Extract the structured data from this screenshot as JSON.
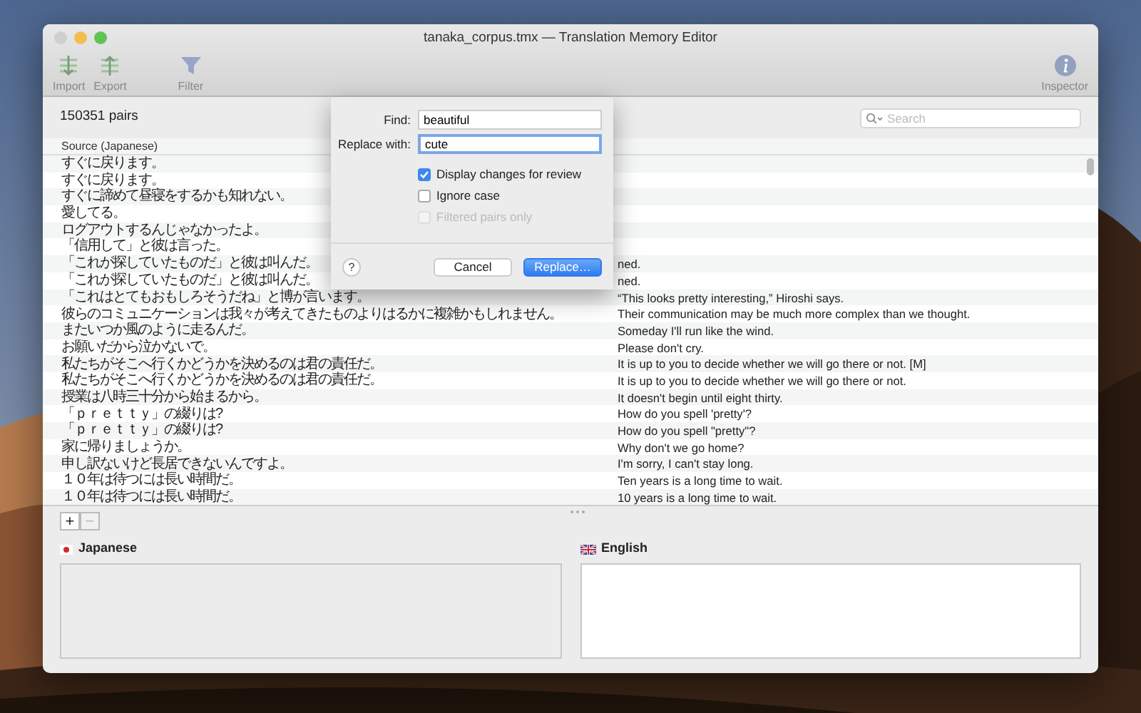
{
  "window": {
    "title": "tanaka_corpus.tmx — Translation Memory Editor"
  },
  "toolbar": [
    {
      "label": "Import",
      "kind": "import"
    },
    {
      "label": "Export",
      "kind": "export"
    },
    {
      "label": "Filter",
      "kind": "filter"
    },
    {
      "label": "Inspector",
      "kind": "info"
    }
  ],
  "pair_count": "150351 pairs",
  "search": {
    "placeholder": "Search"
  },
  "table": {
    "columns": [
      "Source (Japanese)"
    ],
    "rows": [
      {
        "source": "すぐに戻ります。"
      },
      {
        "source": "すぐに戻ります。"
      },
      {
        "source": "すぐに諦めて昼寝をするかも知れない。"
      },
      {
        "source": "愛してる。"
      },
      {
        "source": "ログアウトするんじゃなかったよ。"
      },
      {
        "source": "「信用して」と彼は言った。"
      },
      {
        "source": "「これが探していたものだ」と彼は叫んだ。",
        "target": "ned."
      },
      {
        "source": "「これが探していたものだ」と彼は叫んだ。",
        "target": "ned."
      },
      {
        "source": "「これはとてもおもしろそうだね」と博が言います。",
        "target": "“This looks pretty interesting,” Hiroshi says."
      },
      {
        "source": "彼らのコミュニケーションは我々が考えてきたものよりはるかに複雑かもしれません。",
        "target": "Their communication may be much more complex than we thought."
      },
      {
        "source": "またいつか風のように走るんだ。",
        "target": "Someday I'll run like the wind."
      },
      {
        "source": "お願いだから泣かないで。",
        "target": "Please don't cry."
      },
      {
        "source": "私たちがそこへ行くかどうかを決めるのは君の責任だ。",
        "target": "It is up to you to decide whether we will go there or not. [M]"
      },
      {
        "source": "私たちがそこへ行くかどうかを決めるのは君の責任だ。",
        "target": "It is up to you to decide whether we will go there or not."
      },
      {
        "source": "授業は八時三十分から始まるから。",
        "target": "It doesn't begin until eight thirty."
      },
      {
        "source": "「ｐｒｅｔｔｙ」の綴りは?",
        "target": "How do you spell 'pretty'?"
      },
      {
        "source": "「ｐｒｅｔｔｙ」の綴りは?",
        "target": "How do you spell \"pretty\"?"
      },
      {
        "source": "家に帰りましょうか。",
        "target": "Why don't we go home?"
      },
      {
        "source": "申し訳ないけど長居できないんですよ。",
        "target": "I'm sorry, I can't stay long."
      },
      {
        "source": "１０年は待つには長い時間だ。",
        "target": "Ten years is a long time to wait."
      },
      {
        "source": "１０年は待つには長い時間だ。",
        "target": "10 years is a long time to wait."
      }
    ]
  },
  "editor": {
    "buttons": [
      {
        "label": "+",
        "disabled": false
      },
      {
        "label": "−",
        "disabled": true
      }
    ],
    "panes": [
      {
        "language": "Japanese",
        "kind": "jp",
        "disabled": true
      },
      {
        "language": "English",
        "kind": "gb",
        "disabled": false
      }
    ]
  },
  "dialog": {
    "fields": [
      {
        "label": "Find:",
        "value": "beautiful",
        "focused": false
      },
      {
        "label": "Replace with:",
        "value": "cute",
        "focused": true
      }
    ],
    "options": [
      {
        "label": "Display changes for review",
        "checked": true,
        "disabled": false
      },
      {
        "label": "Ignore case",
        "checked": false,
        "disabled": false
      },
      {
        "label": "Filtered pairs only",
        "checked": false,
        "disabled": true
      }
    ],
    "help": "?",
    "buttons": [
      {
        "label": "Cancel",
        "default": false
      },
      {
        "label": "Replace…",
        "default": true
      }
    ]
  }
}
